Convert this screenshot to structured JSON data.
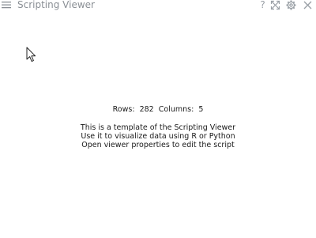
{
  "window": {
    "title": "Scripting Viewer"
  },
  "toolbar": {
    "icons": [
      "help-icon",
      "expand-icon",
      "gear-icon",
      "close-icon"
    ],
    "help_label": "?"
  },
  "main": {
    "rows_label": "Rows:",
    "rows_value": "282",
    "columns_label": "Columns:",
    "columns_value": "5",
    "messages": [
      "This is a template of the Scripting Viewer",
      "Use it to visualize data using R or Python",
      "Open viewer properties to edit the script"
    ]
  },
  "colors": {
    "title": "#8a8f95",
    "icon": "#9aa0a6",
    "text": "#1a1a1a",
    "background": "#ffffff"
  }
}
